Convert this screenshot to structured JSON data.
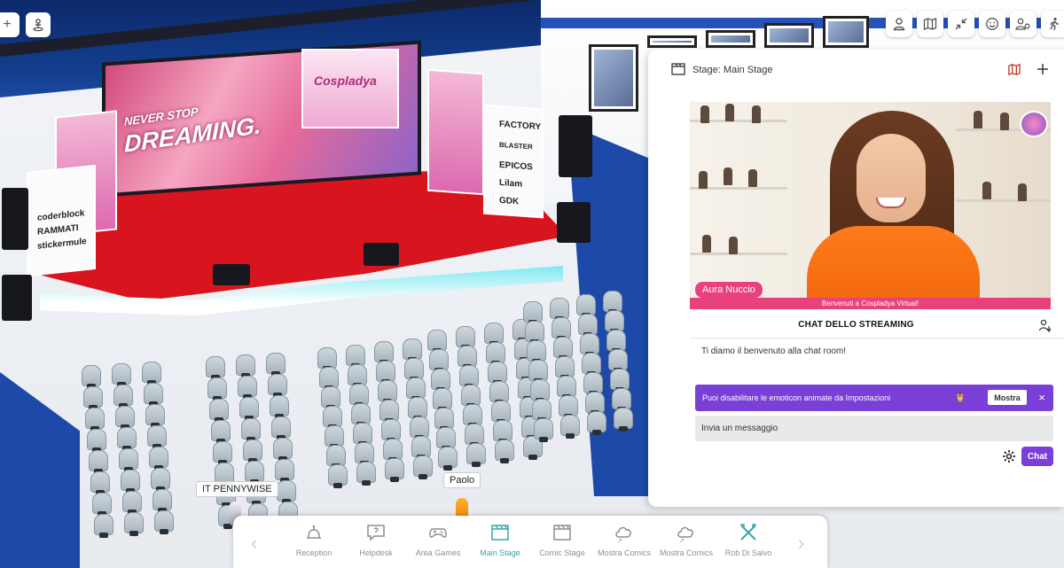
{
  "panel": {
    "title": "Stage: Main Stage",
    "video": {
      "speaker_name": "Aura Nuccio",
      "caption": "Benvenuti a Cospladya Virtual!"
    },
    "chat": {
      "title": "CHAT DELLO STREAMING",
      "welcome_message": "Ti diamo il benvenuto alla chat room!",
      "notice": {
        "text": "Puoi disabilitare le emoticon animate da Impostazioni",
        "button_label": "Mostra",
        "close_label": "×"
      },
      "input_placeholder": "Invia un messaggio",
      "send_label": "Chat"
    }
  },
  "scene": {
    "screen_text_1": "NEVER STOP",
    "screen_text_2": "DREAMING.",
    "stage_logo_text": "Cospladya",
    "sponsors_left": [
      "coderblock",
      "RAMMATI",
      "stickermule"
    ],
    "sponsors_right": [
      "FACTORY",
      "BLASTER",
      "EPICOS",
      "Lilam",
      "GDK"
    ],
    "users": [
      "IT PENNYWISE",
      "Paolo"
    ]
  },
  "nav": {
    "items": [
      {
        "label": "Reception",
        "icon": "bell-icon",
        "active": false
      },
      {
        "label": "Helpdesk",
        "icon": "help-chat-icon",
        "active": false
      },
      {
        "label": "Area Games",
        "icon": "gamepad-icon",
        "active": false
      },
      {
        "label": "Main Stage",
        "icon": "clapperboard-icon",
        "active": true
      },
      {
        "label": "Comic Stage",
        "icon": "clapperboard-icon",
        "active": false
      },
      {
        "label": "Mostra Comics",
        "icon": "cloud-icon",
        "active": false
      },
      {
        "label": "Mostra Comics",
        "icon": "cloud-icon",
        "active": false
      },
      {
        "label": "Rob Di Salvo",
        "icon": "crossed-tools-icon",
        "active": false
      }
    ]
  },
  "colors": {
    "accent_purple": "#7a3fd6",
    "accent_pink": "#e8417e",
    "active_teal": "#3aa6a6",
    "map_icon_red": "#c0392b"
  }
}
